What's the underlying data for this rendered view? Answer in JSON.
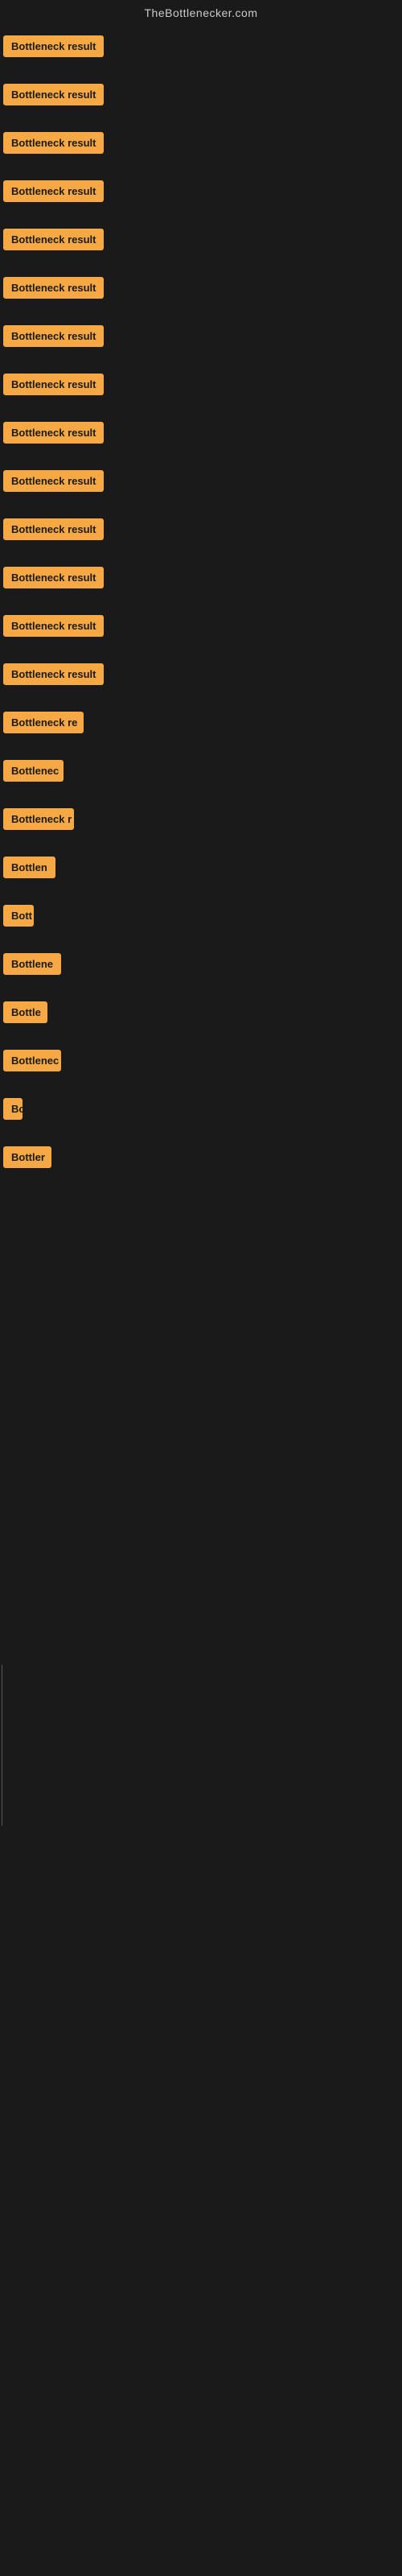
{
  "header": {
    "title": "TheBottlenecker.com"
  },
  "rows": [
    {
      "id": 1,
      "label": "Bottleneck result",
      "class": "row-1"
    },
    {
      "id": 2,
      "label": "Bottleneck result",
      "class": "row-2"
    },
    {
      "id": 3,
      "label": "Bottleneck result",
      "class": "row-3"
    },
    {
      "id": 4,
      "label": "Bottleneck result",
      "class": "row-4"
    },
    {
      "id": 5,
      "label": "Bottleneck result",
      "class": "row-5"
    },
    {
      "id": 6,
      "label": "Bottleneck result",
      "class": "row-6"
    },
    {
      "id": 7,
      "label": "Bottleneck result",
      "class": "row-7"
    },
    {
      "id": 8,
      "label": "Bottleneck result",
      "class": "row-8"
    },
    {
      "id": 9,
      "label": "Bottleneck result",
      "class": "row-9"
    },
    {
      "id": 10,
      "label": "Bottleneck result",
      "class": "row-10"
    },
    {
      "id": 11,
      "label": "Bottleneck result",
      "class": "row-11"
    },
    {
      "id": 12,
      "label": "Bottleneck result",
      "class": "row-12"
    },
    {
      "id": 13,
      "label": "Bottleneck result",
      "class": "row-13"
    },
    {
      "id": 14,
      "label": "Bottleneck result",
      "class": "row-14"
    },
    {
      "id": 15,
      "label": "Bottleneck re",
      "class": "row-15"
    },
    {
      "id": 16,
      "label": "Bottlenec",
      "class": "row-16"
    },
    {
      "id": 17,
      "label": "Bottleneck r",
      "class": "row-17"
    },
    {
      "id": 18,
      "label": "Bottlen",
      "class": "row-18"
    },
    {
      "id": 19,
      "label": "Bott",
      "class": "row-19"
    },
    {
      "id": 20,
      "label": "Bottlene",
      "class": "row-20"
    },
    {
      "id": 21,
      "label": "Bottle",
      "class": "row-21"
    },
    {
      "id": 22,
      "label": "Bottlenec",
      "class": "row-22"
    },
    {
      "id": 23,
      "label": "Bo",
      "class": "row-23"
    },
    {
      "id": 24,
      "label": "Bottler",
      "class": "row-24"
    }
  ],
  "accent_color": "#f5a843"
}
